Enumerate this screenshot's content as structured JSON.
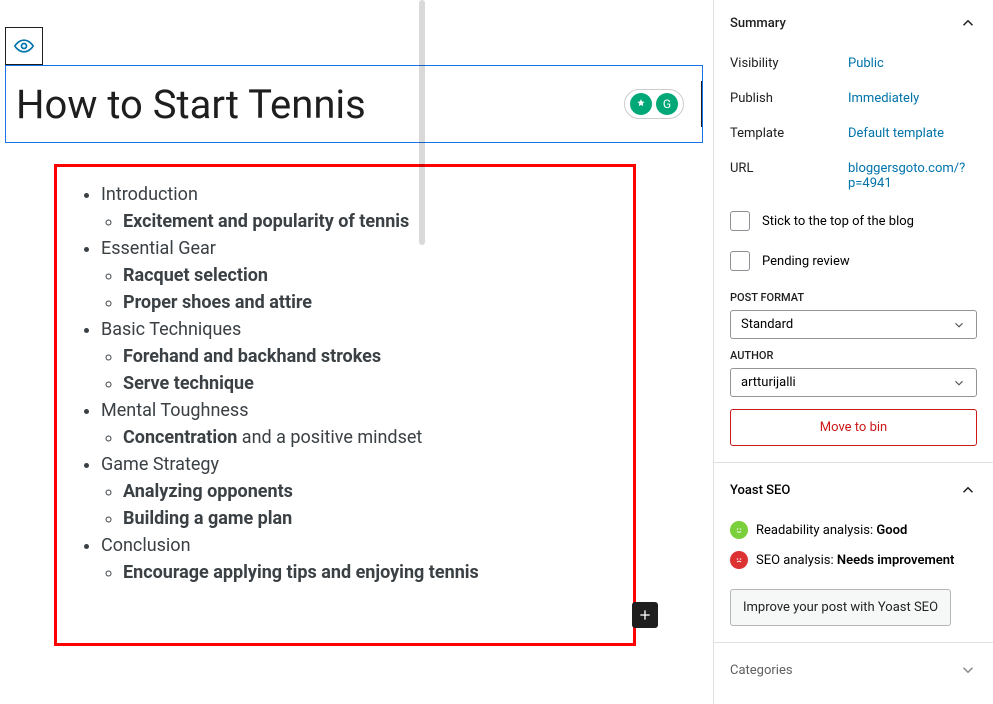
{
  "editor": {
    "title": "How to Start Tennis",
    "outline": [
      {
        "label": "Introduction",
        "children": [
          {
            "bold": "Excitement and popularity of tennis"
          }
        ]
      },
      {
        "label": "Essential Gear",
        "children": [
          {
            "bold": "Racquet selection"
          },
          {
            "bold": "Proper shoes and attire"
          }
        ]
      },
      {
        "label": "Basic Techniques",
        "children": [
          {
            "bold": "Forehand and backhand strokes"
          },
          {
            "bold": "Serve technique"
          }
        ]
      },
      {
        "label": "Mental Toughness",
        "children": [
          {
            "bold": "Concentration",
            "rest": " and a positive mindset"
          }
        ]
      },
      {
        "label": "Game Strategy",
        "children": [
          {
            "bold": "Analyzing opponents"
          },
          {
            "bold": "Building a game plan"
          }
        ]
      },
      {
        "label": "Conclusion",
        "children": [
          {
            "bold": "Encourage applying tips and enjoying tennis"
          }
        ]
      }
    ]
  },
  "sidebar": {
    "summary_title": "Summary",
    "visibility_label": "Visibility",
    "visibility_value": "Public",
    "publish_label": "Publish",
    "publish_value": "Immediately",
    "template_label": "Template",
    "template_value": "Default template",
    "url_label": "URL",
    "url_value": "bloggersgoto.com/?p=4941",
    "stick_label": "Stick to the top of the blog",
    "pending_label": "Pending review",
    "post_format_label": "POST FORMAT",
    "post_format_value": "Standard",
    "author_label": "AUTHOR",
    "author_value": "artturijalli",
    "move_bin": "Move to bin",
    "yoast_title": "Yoast SEO",
    "readability_label": "Readability analysis: ",
    "readability_value": "Good",
    "seo_label": "SEO analysis: ",
    "seo_value": "Needs improvement",
    "improve_btn": "Improve your post with Yoast SEO",
    "categories_title": "Categories"
  }
}
